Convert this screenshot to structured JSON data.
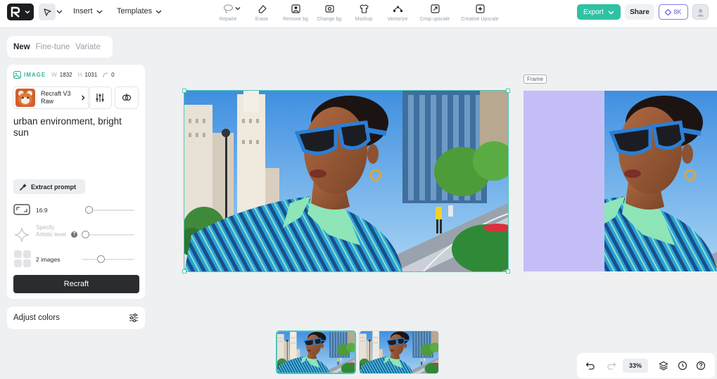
{
  "header": {
    "menus": [
      "Insert",
      "Templates"
    ],
    "tools": [
      "Repaint",
      "Erase",
      "Remove bg",
      "Change bg",
      "Mockup",
      "Vectorize",
      "Crisp upscale",
      "Creative Upscale"
    ],
    "export_label": "Export",
    "share_label": "Share",
    "credits_label": "8K"
  },
  "sidebar": {
    "tabs": [
      "New",
      "Fine-tune",
      "Variate"
    ],
    "image_label": "IMAGE",
    "width_key": "W",
    "width_value": "1832",
    "height_key": "H",
    "height_value": "1031",
    "rotation_value": "0",
    "model_name": "Recraft V3 Raw",
    "prompt": "urban environment, bright sun",
    "extract_label": "Extract prompt",
    "aspect_label": "16:9",
    "artistic_label": "Specify Artistic level",
    "artistic_info": "?",
    "images_label": "2 images",
    "recraft_label": "Recraft",
    "adjust_label": "Adjust colors"
  },
  "canvas": {
    "frame_label": "Frame",
    "frame_color": "#c3bff6",
    "zoom_label": "33%"
  }
}
